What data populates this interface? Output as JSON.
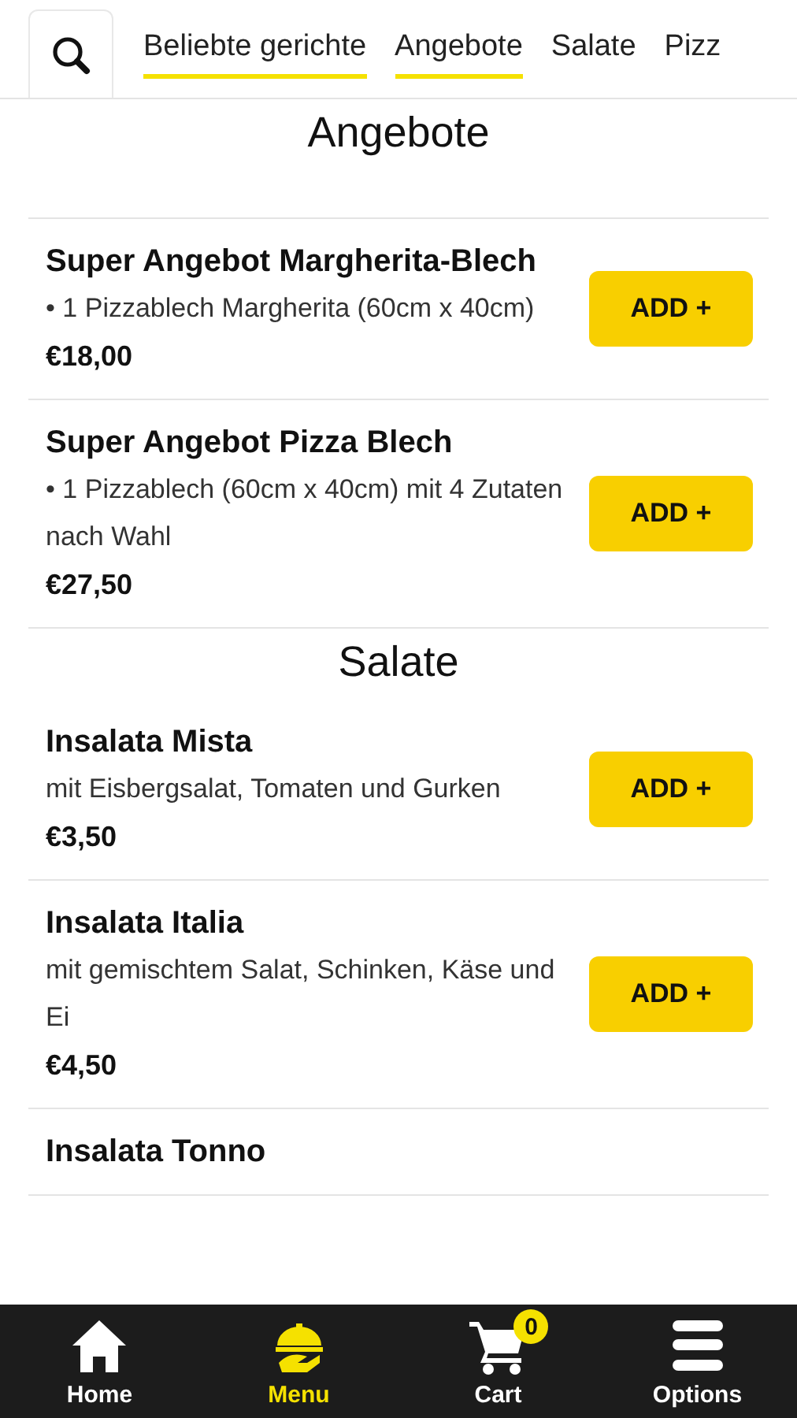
{
  "tabs": [
    {
      "label": "Beliebte gerichte",
      "selected": true
    },
    {
      "label": "Angebote",
      "selected": true
    },
    {
      "label": "Salate",
      "selected": false
    },
    {
      "label": "Pizz",
      "selected": false
    }
  ],
  "sections": [
    {
      "title": "Angebote",
      "items": [
        {
          "name": "Super Angebot Margherita-Blech",
          "description": "• 1 Pizzablech Margherita (60cm x 40cm)",
          "price": "€18,00",
          "button": "ADD +"
        },
        {
          "name": "Super Angebot Pizza Blech",
          "description": "• 1 Pizzablech (60cm x 40cm) mit 4 Zutaten nach Wahl",
          "price": "€27,50",
          "button": "ADD +"
        }
      ]
    },
    {
      "title": "Salate",
      "items": [
        {
          "name": "Insalata Mista",
          "description": "mit Eisbergsalat, Tomaten und Gurken",
          "price": "€3,50",
          "button": "ADD +"
        },
        {
          "name": "Insalata Italia",
          "description": "mit gemischtem Salat, Schinken, Käse und Ei",
          "price": "€4,50",
          "button": "ADD +"
        },
        {
          "name": "Insalata Tonno"
        }
      ]
    }
  ],
  "nav": [
    {
      "kind": "home",
      "label": "Home",
      "selected": false
    },
    {
      "kind": "menu",
      "label": "Menu",
      "selected": true
    },
    {
      "kind": "cart",
      "label": "Cart",
      "selected": false,
      "badge": "0"
    },
    {
      "kind": "options",
      "label": "Options",
      "selected": false
    }
  ]
}
